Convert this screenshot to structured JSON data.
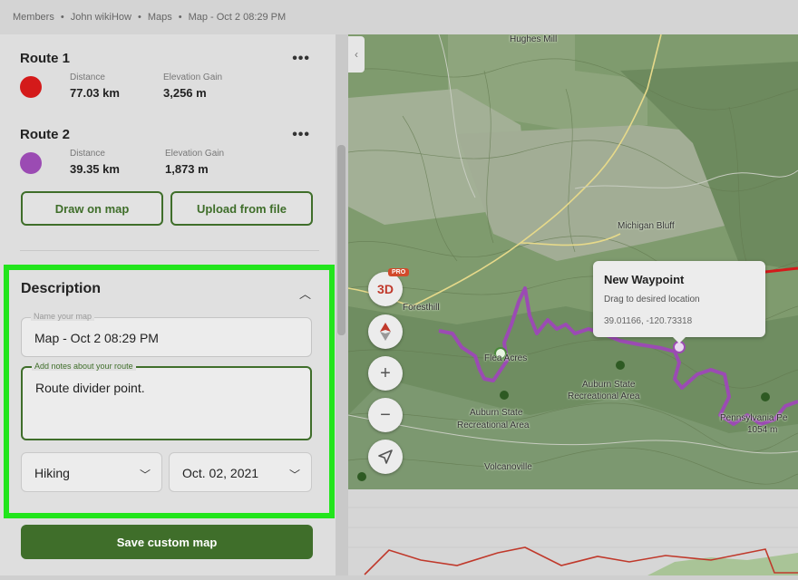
{
  "breadcrumb": [
    "Members",
    "John wikiHow",
    "Maps",
    "Map - Oct 2 08:29 PM"
  ],
  "routes": [
    {
      "title": "Route 1",
      "color": "#d41a1a",
      "distance_label": "Distance",
      "distance": "77.03 km",
      "gain_label": "Elevation Gain",
      "gain": "3,256 m",
      "menu": "•••"
    },
    {
      "title": "Route 2",
      "color": "#9b4bb3",
      "distance_label": "Distance",
      "distance": "39.35 km",
      "gain_label": "Elevation Gain",
      "gain": "1,873 m",
      "menu": "•••"
    }
  ],
  "buttons": {
    "draw": "Draw on map",
    "upload": "Upload from file",
    "save": "Save custom map"
  },
  "description": {
    "title": "Description",
    "name_label": "Name your map",
    "name_value": "Map - Oct 2 08:29 PM",
    "notes_label": "Add notes about your route",
    "notes_value": "Route divider point.",
    "activity": "Hiking",
    "date": "Oct. 02, 2021"
  },
  "map": {
    "labels": {
      "hughes": "Hughes Mill",
      "michigan": "Michigan Bluff",
      "foresthill": "Foresthill",
      "flea": "Flea Acres",
      "auburn1a": "Auburn State",
      "auburn1b": "Recreational Area",
      "auburn2a": "Auburn State",
      "auburn2b": "Recreational Area",
      "volcanoville": "Volcanoville",
      "penny": "Pennsylvania Pe",
      "penny_elev": "1054 m"
    },
    "controls": {
      "three_d": "3D",
      "pro": "PRO",
      "zoom_in": "+",
      "zoom_out": "−"
    },
    "popup": {
      "title": "New Waypoint",
      "subtitle": "Drag to desired location",
      "coords": "39.01166, -120.73318"
    }
  },
  "colors": {
    "accent": "#3f6e2a",
    "highlight": "#22e51c",
    "route1": "#d41a1a",
    "route2": "#9b4bb3"
  }
}
